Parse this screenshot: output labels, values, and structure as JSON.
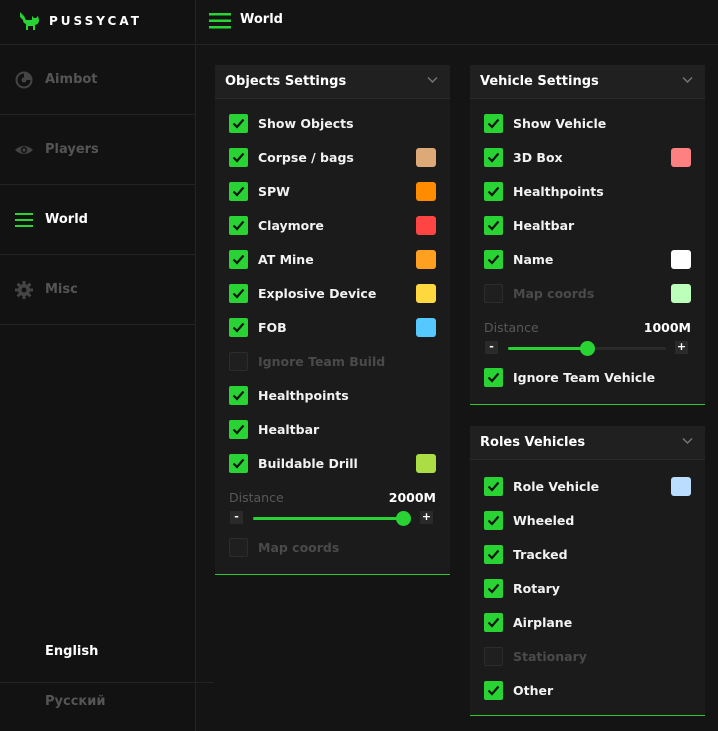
{
  "app": {
    "brand": "PUSSYCAT",
    "page_title": "World"
  },
  "colors": {
    "accent": "#29d334",
    "muted": "#555555"
  },
  "sidebar": {
    "items": [
      {
        "label": "Aimbot",
        "icon": "aimbot-icon",
        "active": false
      },
      {
        "label": "Players",
        "icon": "eye-icon",
        "active": false
      },
      {
        "label": "World",
        "icon": "menu-lines-icon",
        "active": true
      },
      {
        "label": "Misc",
        "icon": "gear-icon",
        "active": false
      }
    ],
    "languages": [
      {
        "label": "English",
        "active": true
      },
      {
        "label": "Русский",
        "active": false
      }
    ]
  },
  "objects_panel": {
    "title": "Objects Settings",
    "rows": [
      {
        "label": "Show Objects",
        "checked": true
      },
      {
        "label": "Corpse / bags",
        "checked": true,
        "color": "#ddaa77"
      },
      {
        "label": "SPW",
        "checked": true,
        "color": "#ff8c00"
      },
      {
        "label": "Claymore",
        "checked": true,
        "color": "#ff4444"
      },
      {
        "label": "AT Mine",
        "checked": true,
        "color": "#ffa020"
      },
      {
        "label": "Explosive Device",
        "checked": true,
        "color": "#ffd840"
      },
      {
        "label": "FOB",
        "checked": true,
        "color": "#55c8ff"
      },
      {
        "label": "Ignore Team Build",
        "checked": false
      },
      {
        "label": "Healthpoints",
        "checked": true
      },
      {
        "label": "Healtbar",
        "checked": true
      },
      {
        "label": "Buildable Drill",
        "checked": true,
        "color": "#aade44"
      }
    ],
    "distance": {
      "label": "Distance",
      "value": "2000M",
      "fraction": 1.0,
      "minus": "-",
      "plus": "+"
    },
    "after_rows": [
      {
        "label": "Map coords",
        "checked": false
      }
    ]
  },
  "vehicle_panel": {
    "title": "Vehicle Settings",
    "rows": [
      {
        "label": "Show Vehicle",
        "checked": true
      },
      {
        "label": "3D Box",
        "checked": true,
        "color": "#ff8080"
      },
      {
        "label": "Healthpoints",
        "checked": true
      },
      {
        "label": "Healtbar",
        "checked": true
      },
      {
        "label": "Name",
        "checked": true,
        "color": "#ffffff"
      },
      {
        "label": "Map coords",
        "checked": false,
        "color": "#bbffbb"
      }
    ],
    "distance": {
      "label": "Distance",
      "value": "1000M",
      "fraction": 0.5,
      "minus": "-",
      "plus": "+"
    },
    "after_rows": [
      {
        "label": "Ignore Team Vehicle",
        "checked": true
      }
    ]
  },
  "roles_panel": {
    "title": "Roles Vehicles",
    "rows": [
      {
        "label": "Role Vehicle",
        "checked": true,
        "color": "#bbddff"
      },
      {
        "label": "Wheeled",
        "checked": true
      },
      {
        "label": "Tracked",
        "checked": true
      },
      {
        "label": "Rotary",
        "checked": true
      },
      {
        "label": "Airplane",
        "checked": true
      },
      {
        "label": "Stationary",
        "checked": false
      },
      {
        "label": "Other",
        "checked": true
      }
    ]
  }
}
